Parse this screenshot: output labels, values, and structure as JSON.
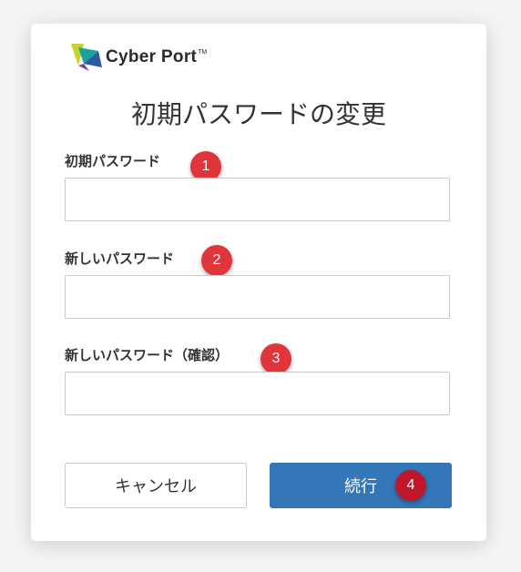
{
  "logo": {
    "text": "Cyber Port",
    "tm": "TM"
  },
  "page_title": "初期パスワードの変更",
  "fields": [
    {
      "label": "初期パスワード",
      "value": "",
      "badge": "1"
    },
    {
      "label": "新しいパスワード",
      "value": "",
      "badge": "2"
    },
    {
      "label": "新しいパスワード（確認）",
      "value": "",
      "badge": "3"
    }
  ],
  "buttons": {
    "cancel_label": "キャンセル",
    "continue_label": "続行",
    "continue_badge": "4"
  },
  "colors": {
    "primary": "#3377b8",
    "badge": "#e0353a",
    "badge_dark": "#c0182a",
    "logo_teal": "#1aa39a",
    "logo_yellow": "#c9d12c",
    "logo_blue": "#2c5aa0"
  }
}
